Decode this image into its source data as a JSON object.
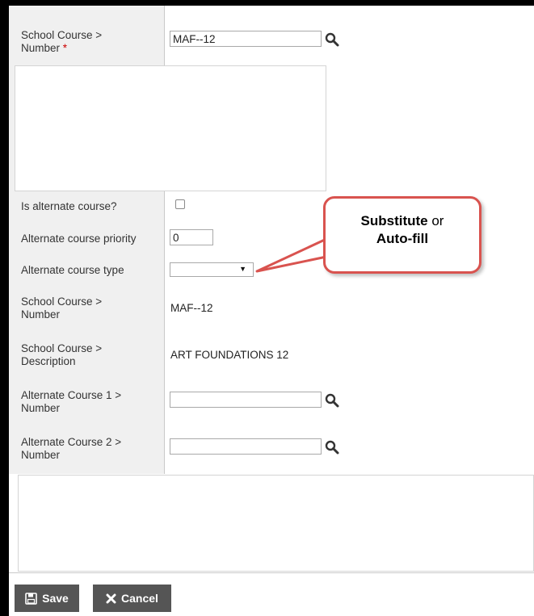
{
  "form": {
    "school_course_number_label": "School Course >",
    "school_course_number_label2": "Number",
    "required_marker": "*",
    "school_course_number_value": "MAF--12",
    "is_alternate_label": "Is alternate course?",
    "alt_priority_label": "Alternate course priority",
    "alt_priority_value": "0",
    "alt_type_label": "Alternate course type",
    "alt_type_arrow": "▼",
    "ro_number_label": "School Course >",
    "ro_number_label2": "Number",
    "ro_number_value": "MAF--12",
    "ro_desc_label": "School Course >",
    "ro_desc_label2": "Description",
    "ro_desc_value": "ART FOUNDATIONS 12",
    "alt1_label": "Alternate Course 1 >",
    "alt1_label2": "Number",
    "alt1_value": "",
    "alt2_label": "Alternate Course 2 >",
    "alt2_label2": "Number",
    "alt2_value": ""
  },
  "callout": {
    "word1": "Substitute",
    "word2": " or",
    "word3": "Auto-fill"
  },
  "buttons": {
    "save_label": "Save",
    "cancel_label": "Cancel"
  },
  "icons": {
    "search": "search-icon",
    "save": "floppy-disk-icon",
    "cancel": "x-icon"
  },
  "colors": {
    "label_bg": "#f0f0f0",
    "button_bg": "#555555",
    "callout_border": "#d9534f",
    "required": "#cc0000"
  }
}
